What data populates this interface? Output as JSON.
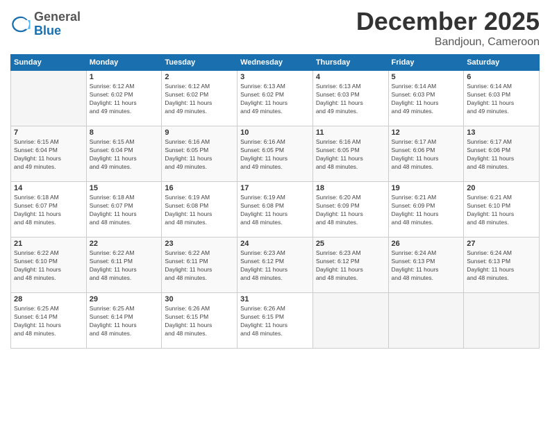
{
  "logo": {
    "general": "General",
    "blue": "Blue"
  },
  "title": "December 2025",
  "location": "Bandjoun, Cameroon",
  "days_of_week": [
    "Sunday",
    "Monday",
    "Tuesday",
    "Wednesday",
    "Thursday",
    "Friday",
    "Saturday"
  ],
  "weeks": [
    [
      {
        "day": "",
        "info": ""
      },
      {
        "day": "1",
        "info": "Sunrise: 6:12 AM\nSunset: 6:02 PM\nDaylight: 11 hours\nand 49 minutes."
      },
      {
        "day": "2",
        "info": "Sunrise: 6:12 AM\nSunset: 6:02 PM\nDaylight: 11 hours\nand 49 minutes."
      },
      {
        "day": "3",
        "info": "Sunrise: 6:13 AM\nSunset: 6:02 PM\nDaylight: 11 hours\nand 49 minutes."
      },
      {
        "day": "4",
        "info": "Sunrise: 6:13 AM\nSunset: 6:03 PM\nDaylight: 11 hours\nand 49 minutes."
      },
      {
        "day": "5",
        "info": "Sunrise: 6:14 AM\nSunset: 6:03 PM\nDaylight: 11 hours\nand 49 minutes."
      },
      {
        "day": "6",
        "info": "Sunrise: 6:14 AM\nSunset: 6:03 PM\nDaylight: 11 hours\nand 49 minutes."
      }
    ],
    [
      {
        "day": "7",
        "info": "Sunrise: 6:15 AM\nSunset: 6:04 PM\nDaylight: 11 hours\nand 49 minutes."
      },
      {
        "day": "8",
        "info": "Sunrise: 6:15 AM\nSunset: 6:04 PM\nDaylight: 11 hours\nand 49 minutes."
      },
      {
        "day": "9",
        "info": "Sunrise: 6:16 AM\nSunset: 6:05 PM\nDaylight: 11 hours\nand 49 minutes."
      },
      {
        "day": "10",
        "info": "Sunrise: 6:16 AM\nSunset: 6:05 PM\nDaylight: 11 hours\nand 49 minutes."
      },
      {
        "day": "11",
        "info": "Sunrise: 6:16 AM\nSunset: 6:05 PM\nDaylight: 11 hours\nand 48 minutes."
      },
      {
        "day": "12",
        "info": "Sunrise: 6:17 AM\nSunset: 6:06 PM\nDaylight: 11 hours\nand 48 minutes."
      },
      {
        "day": "13",
        "info": "Sunrise: 6:17 AM\nSunset: 6:06 PM\nDaylight: 11 hours\nand 48 minutes."
      }
    ],
    [
      {
        "day": "14",
        "info": "Sunrise: 6:18 AM\nSunset: 6:07 PM\nDaylight: 11 hours\nand 48 minutes."
      },
      {
        "day": "15",
        "info": "Sunrise: 6:18 AM\nSunset: 6:07 PM\nDaylight: 11 hours\nand 48 minutes."
      },
      {
        "day": "16",
        "info": "Sunrise: 6:19 AM\nSunset: 6:08 PM\nDaylight: 11 hours\nand 48 minutes."
      },
      {
        "day": "17",
        "info": "Sunrise: 6:19 AM\nSunset: 6:08 PM\nDaylight: 11 hours\nand 48 minutes."
      },
      {
        "day": "18",
        "info": "Sunrise: 6:20 AM\nSunset: 6:09 PM\nDaylight: 11 hours\nand 48 minutes."
      },
      {
        "day": "19",
        "info": "Sunrise: 6:21 AM\nSunset: 6:09 PM\nDaylight: 11 hours\nand 48 minutes."
      },
      {
        "day": "20",
        "info": "Sunrise: 6:21 AM\nSunset: 6:10 PM\nDaylight: 11 hours\nand 48 minutes."
      }
    ],
    [
      {
        "day": "21",
        "info": "Sunrise: 6:22 AM\nSunset: 6:10 PM\nDaylight: 11 hours\nand 48 minutes."
      },
      {
        "day": "22",
        "info": "Sunrise: 6:22 AM\nSunset: 6:11 PM\nDaylight: 11 hours\nand 48 minutes."
      },
      {
        "day": "23",
        "info": "Sunrise: 6:22 AM\nSunset: 6:11 PM\nDaylight: 11 hours\nand 48 minutes."
      },
      {
        "day": "24",
        "info": "Sunrise: 6:23 AM\nSunset: 6:12 PM\nDaylight: 11 hours\nand 48 minutes."
      },
      {
        "day": "25",
        "info": "Sunrise: 6:23 AM\nSunset: 6:12 PM\nDaylight: 11 hours\nand 48 minutes."
      },
      {
        "day": "26",
        "info": "Sunrise: 6:24 AM\nSunset: 6:13 PM\nDaylight: 11 hours\nand 48 minutes."
      },
      {
        "day": "27",
        "info": "Sunrise: 6:24 AM\nSunset: 6:13 PM\nDaylight: 11 hours\nand 48 minutes."
      }
    ],
    [
      {
        "day": "28",
        "info": "Sunrise: 6:25 AM\nSunset: 6:14 PM\nDaylight: 11 hours\nand 48 minutes."
      },
      {
        "day": "29",
        "info": "Sunrise: 6:25 AM\nSunset: 6:14 PM\nDaylight: 11 hours\nand 48 minutes."
      },
      {
        "day": "30",
        "info": "Sunrise: 6:26 AM\nSunset: 6:15 PM\nDaylight: 11 hours\nand 48 minutes."
      },
      {
        "day": "31",
        "info": "Sunrise: 6:26 AM\nSunset: 6:15 PM\nDaylight: 11 hours\nand 48 minutes."
      },
      {
        "day": "",
        "info": ""
      },
      {
        "day": "",
        "info": ""
      },
      {
        "day": "",
        "info": ""
      }
    ]
  ]
}
